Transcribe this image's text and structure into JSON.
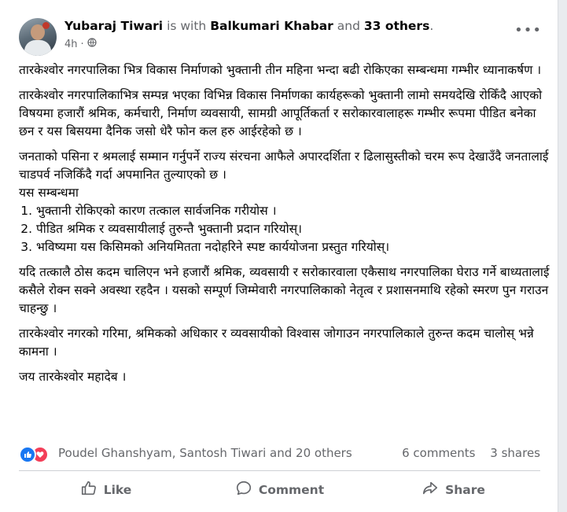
{
  "post": {
    "author": "Yubaraj Tiwari",
    "with_text": "is with",
    "tagged": "Balkumari Khabar",
    "and_text": "and",
    "others": "33 others",
    "period": ".",
    "time": "4h",
    "privacy_icon": "globe-icon",
    "more_icon": "more-options-icon",
    "more_label": "•••",
    "paragraphs": [
      "तारकेश्वोर नगरपालिका भित्र विकास निर्माणको भुक्तानी तीन महिना भन्दा बढी रोकिएका सम्बन्धमा गम्भीर ध्यानाकर्षण ।",
      "तारकेश्वोर नगरपालिकाभित्र सम्पन्न भएका विभिन्न विकास निर्माणका कार्यहरूको भुक्तानी लामो समयदेखि रोकिँदै आएको विषयमा हजारौं श्रमिक, कर्मचारी, निर्माण व्यवसायी, सामग्री आपूर्तिकर्ता र सरोकारवालाहरू गम्भीर रूपमा पीडित बनेका छन र यस बिसयमा दैनिक जसो धेरै फोन कल हरु आईरहेको छ ।",
      "जनताको पसिना र श्रमलाई सम्मान गर्नुपर्ने राज्य संरचना आफैले अपारदर्शिता र ढिलासुस्तीको चरम रूप देखाउँदै जनतालाई चाडपर्व नजिकिँदै गर्दा अपमानित तुल्याएको छ ।",
      "यदि तत्कालै ठोस कदम चालिएन भने हजारौं श्रमिक, व्यवसायी र सरोकारवाला एकैसाथ नगरपालिका घेराउ गर्ने बाध्यतालाई कसैले रोक्न सक्ने अवस्था रहदैन । यसको सम्पूर्ण जिम्मेवारी नगरपालिकाको नेतृत्व र प्रशासनमाथि रहेको स्मरण पुन गराउन चाहन्छु ।",
      "तारकेश्वोर नगरको गरिमा, श्रमिकको अधिकार र व्यवसायीको विश्वास जोगाउन नगरपालिकाले तुरुन्त कदम चालोस् भन्ने कामना ।",
      "जय तारकेश्वोर महादेब ।"
    ],
    "list_heading": "यस सम्बन्धमा",
    "list_items": [
      "भुक्तानी रोकिएको कारण तत्काल सार्वजनिक गरीयोस ।",
      "पीडित श्रमिक र व्यवसायीलाई तुरुन्तै भुक्तानी प्रदान गरियोस्।",
      "भविष्यमा यस किसिमको अनियमितता नदोहरिने स्पष्ट कार्ययोजना प्रस्तुत गरियोस्।"
    ]
  },
  "reactions": {
    "icons": [
      "like-reaction-icon",
      "love-reaction-icon"
    ],
    "names": "Poudel Ghanshyam, Santosh Tiwari and 20 others",
    "comments": "6 comments",
    "shares": "3 shares"
  },
  "actions": {
    "like": "Like",
    "comment": "Comment",
    "share": "Share"
  },
  "colors": {
    "accent": "#1877f2",
    "love": "#f33e58",
    "secondary_text": "#65676b",
    "primary_text": "#050505"
  }
}
